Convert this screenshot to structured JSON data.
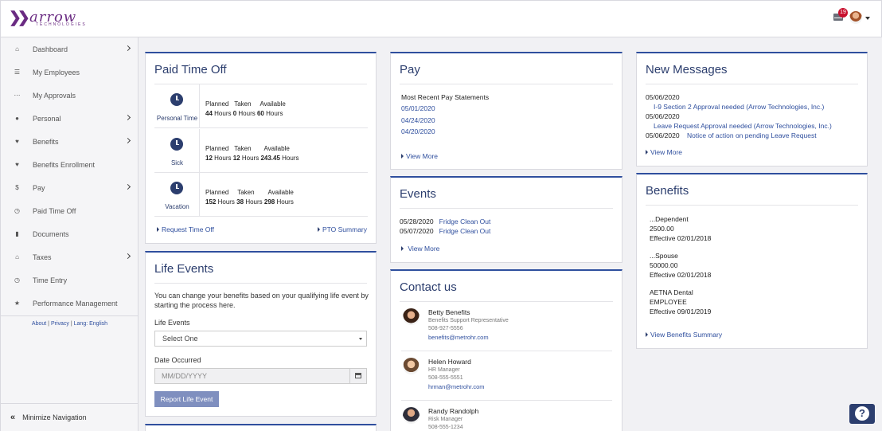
{
  "header": {
    "logo_word": "arrow",
    "logo_sub": "TECHNOLOGIES",
    "notification_count": "19"
  },
  "sidebar": {
    "items": [
      {
        "label": "Dashboard",
        "icon": "home-icon",
        "has_submenu": true
      },
      {
        "label": "My Employees",
        "icon": "list-icon",
        "has_submenu": false
      },
      {
        "label": "My Approvals",
        "icon": "dots-icon",
        "has_submenu": false
      },
      {
        "label": "Personal",
        "icon": "user-icon",
        "has_submenu": true
      },
      {
        "label": "Benefits",
        "icon": "heartbeat-icon",
        "has_submenu": true
      },
      {
        "label": "Benefits Enrollment",
        "icon": "heart-icon",
        "has_submenu": false
      },
      {
        "label": "Pay",
        "icon": "dollar-icon",
        "has_submenu": true
      },
      {
        "label": "Paid Time Off",
        "icon": "clock-icon",
        "has_submenu": false
      },
      {
        "label": "Documents",
        "icon": "document-icon",
        "has_submenu": false
      },
      {
        "label": "Taxes",
        "icon": "bank-icon",
        "has_submenu": true
      },
      {
        "label": "Time Entry",
        "icon": "clock-icon",
        "has_submenu": false
      },
      {
        "label": "Performance Management",
        "icon": "star-icon",
        "has_submenu": false
      }
    ],
    "footer": {
      "about": "About",
      "privacy": "Privacy",
      "lang": "Lang: English",
      "sep": "|"
    },
    "minimize_label": "Minimize Navigation"
  },
  "pto": {
    "title": "Paid Time Off",
    "col_planned": "Planned",
    "col_taken": "Taken",
    "col_available": "Available",
    "unit": "Hours",
    "rows": [
      {
        "name": "Personal Time",
        "planned": "44",
        "taken": "0",
        "available": "60"
      },
      {
        "name": "Sick",
        "planned": "12",
        "taken": "12",
        "available": "243.45"
      },
      {
        "name": "Vacation",
        "planned": "152",
        "taken": "38",
        "available": "298"
      }
    ],
    "request_link": "Request Time Off",
    "summary_link": "PTO Summary"
  },
  "life_events": {
    "title": "Life Events",
    "description": "You can change your benefits based on your qualifying life event by starting the process here.",
    "select_label": "Life Events",
    "select_value": "Select One",
    "date_label": "Date Occurred",
    "date_placeholder": "MM/DD/YYYY",
    "button": "Report Life Event"
  },
  "pay": {
    "title": "Pay",
    "subtitle": "Most Recent Pay Statements",
    "statements": [
      "05/01/2020",
      "04/24/2020",
      "04/20/2020"
    ],
    "view_more": "View More"
  },
  "events": {
    "title": "Events",
    "items": [
      {
        "date": "05/28/2020",
        "name": "Fridge Clean Out"
      },
      {
        "date": "05/07/2020",
        "name": "Fridge Clean Out"
      }
    ],
    "view_more": "View More"
  },
  "contact": {
    "title": "Contact us",
    "people": [
      {
        "name": "Betty Benefits",
        "role": "Benefits Support Representative",
        "phone": "508-927-5556",
        "email": "benefits@metrohr.com"
      },
      {
        "name": "Helen Howard",
        "role": "HR Manager",
        "phone": "508-555-5551",
        "email": "hrman@metrohr.com"
      },
      {
        "name": "Randy Randolph",
        "role": "Risk Manager",
        "phone": "508-555-1234",
        "email": ""
      }
    ]
  },
  "messages": {
    "title": "New Messages",
    "items": [
      {
        "date": "05/06/2020",
        "text": "I-9 Section 2 Approval needed (Arrow Technologies, Inc.)"
      },
      {
        "date": "05/06/2020",
        "text": "Leave Request Approval needed (Arrow Technologies, Inc.)"
      },
      {
        "date": "05/06/2020",
        "text": "Notice of action on pending Leave Request"
      }
    ],
    "view_more": "View More"
  },
  "benefits": {
    "title": "Benefits",
    "items": [
      {
        "line1": "...Dependent",
        "line2": "2500.00",
        "line3": "Effective 02/01/2018"
      },
      {
        "line1": "...Spouse",
        "line2": "50000.00",
        "line3": "Effective 02/01/2018"
      },
      {
        "line1": "AETNA Dental",
        "line2": "EMPLOYEE",
        "line3": "Effective 09/01/2019"
      }
    ],
    "summary_link": "View Benefits Summary"
  },
  "help": {
    "label": "?"
  }
}
